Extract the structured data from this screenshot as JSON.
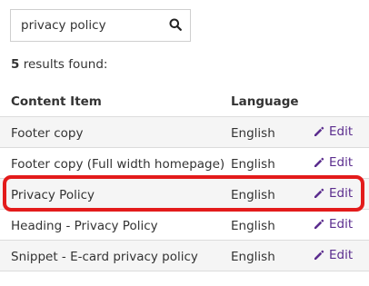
{
  "search": {
    "value": "privacy policy"
  },
  "results": {
    "count": "5",
    "suffix": "results found:"
  },
  "table": {
    "headers": {
      "content_item": "Content Item",
      "language": "Language"
    },
    "rows": [
      {
        "content_item": "Footer copy",
        "language": "English",
        "action": "Edit"
      },
      {
        "content_item": "Footer copy (Full width homepage)",
        "language": "English",
        "action": "Edit"
      },
      {
        "content_item": "Privacy Policy",
        "language": "English",
        "action": "Edit"
      },
      {
        "content_item": "Heading - Privacy Policy",
        "language": "English",
        "action": "Edit"
      },
      {
        "content_item": "Snippet - E-card privacy policy",
        "language": "English",
        "action": "Edit"
      }
    ]
  },
  "icons": {
    "search": "search-icon",
    "edit": "pencil-icon"
  },
  "colors": {
    "link": "#5b2d8e",
    "highlight": "#e31b1b",
    "row_alt": "#f5f5f5"
  }
}
